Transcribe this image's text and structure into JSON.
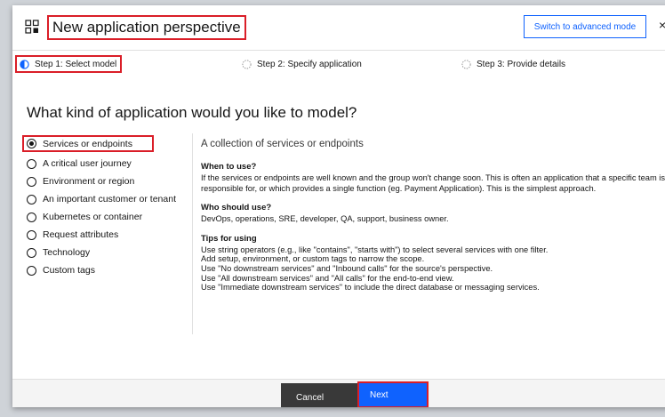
{
  "header": {
    "title": "New application perspective",
    "advanced_button": "Switch to advanced mode",
    "close_glyph": "×"
  },
  "steps": [
    {
      "label": "Step 1: Select model",
      "state": "current"
    },
    {
      "label": "Step 2: Specify application",
      "state": "incomplete"
    },
    {
      "label": "Step 3: Provide details",
      "state": "incomplete"
    }
  ],
  "question": "What kind of application would you like to model?",
  "options": [
    {
      "label": "Services or endpoints",
      "selected": true
    },
    {
      "label": "A critical user journey",
      "selected": false
    },
    {
      "label": "Environment or region",
      "selected": false
    },
    {
      "label": "An important customer or tenant",
      "selected": false
    },
    {
      "label": "Kubernetes or container",
      "selected": false
    },
    {
      "label": "Request attributes",
      "selected": false
    },
    {
      "label": "Technology",
      "selected": false
    },
    {
      "label": "Custom tags",
      "selected": false
    }
  ],
  "description": {
    "heading": "A collection of services or endpoints",
    "when_title": "When to use?",
    "when_text": "If the services or endpoints are well known and the group won't change soon. This is often an application that a specific team is responsible for, or which provides a single function (eg. Payment Application). This is the simplest approach.",
    "who_title": "Who should use?",
    "who_text": "DevOps, operations, SRE, developer, QA, support, business owner.",
    "tips_title": "Tips for using",
    "tips": [
      "Use string operators (e.g., like \"contains\", \"starts with\") to select several services with one filter.",
      "Add setup, environment, or custom tags to narrow the scope.",
      "Use \"No downstream services\" and \"Inbound calls\" for the source's perspective.",
      "Use \"All downstream services\" and \"All calls\" for the end-to-end view.",
      "Use \"Immediate downstream services\" to include the direct database or messaging services."
    ]
  },
  "footer": {
    "cancel": "Cancel",
    "next": "Next"
  },
  "colors": {
    "primary": "#0f62fe",
    "highlight": "#da1e28",
    "secondary_button": "#393939"
  },
  "icons": {
    "app": "application-icon",
    "step_current": "step-in-progress-icon",
    "step_incomplete": "step-incomplete-icon"
  }
}
